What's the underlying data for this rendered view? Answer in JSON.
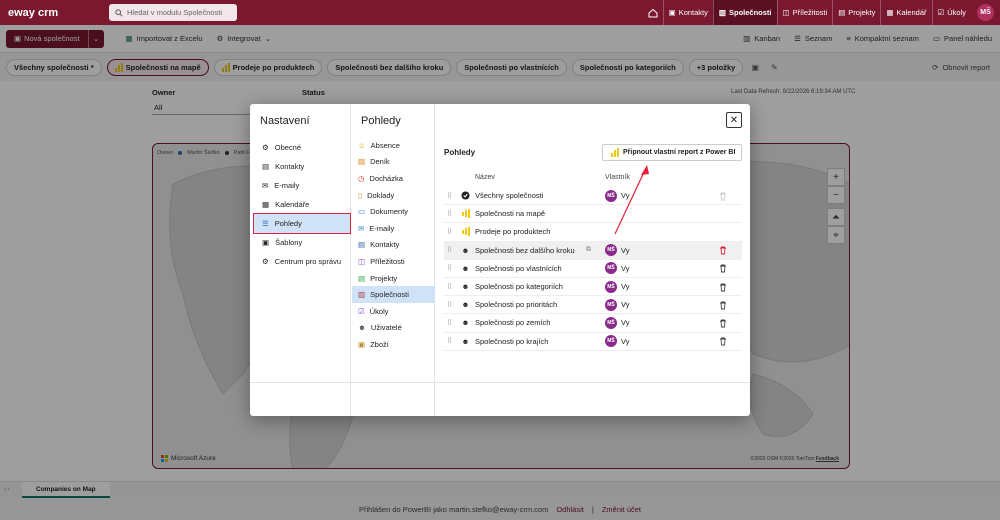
{
  "topbar": {
    "logo": "eway crm",
    "search_placeholder": "Hledat v modulu Společnosti",
    "tabs": [
      {
        "label": "Kontakty",
        "icon": "contacts-icon"
      },
      {
        "label": "Společnosti",
        "icon": "companies-icon",
        "active": true
      },
      {
        "label": "Příležitosti",
        "icon": "opportunities-icon"
      },
      {
        "label": "Projekty",
        "icon": "projects-icon"
      },
      {
        "label": "Kalendář",
        "icon": "calendar-icon"
      },
      {
        "label": "Úkoly",
        "icon": "tasks-icon"
      }
    ],
    "avatar": "MŠ"
  },
  "toolbar": {
    "new_label": "Nová společnost",
    "import_label": "Importovat z Excelu",
    "integrate_label": "Integrovat",
    "kanban_label": "Kanban",
    "list_label": "Seznam",
    "compact_label": "Kompaktní seznam",
    "preview_label": "Panel náhledu"
  },
  "viewbar": {
    "views": [
      {
        "label": "Všechny společnosti *"
      },
      {
        "label": "Společnosti na mapě",
        "active": true
      },
      {
        "label": "Prodeje po produktech"
      },
      {
        "label": "Společnosti bez dalšího kroku"
      },
      {
        "label": "Společnosti po vlastnících"
      },
      {
        "label": "Společnosti po kategoriích"
      },
      {
        "label": "+3 položky"
      }
    ],
    "refresh_label": "Obnovit report"
  },
  "report": {
    "owner_label": "Owner",
    "owner_value": "All",
    "status_label": "Status",
    "last_refresh": "Last Data Refresh: 8/22/2026 6:19:34 AM UTC",
    "legend_owner": "Owner",
    "legend_a": "Martin Štefko",
    "legend_b": "Patti Fer",
    "azure": "Microsoft Azure",
    "copyright": "©2026 OSM ©2026 TomTom",
    "feedback": "Feedback"
  },
  "pagetabs": [
    "Companies on Map"
  ],
  "footer": {
    "signed": "Přihlášen do PowerBI jako martin.stefko@eway-crm.com",
    "logout": "Odhlásit",
    "change": "Změnit účet"
  },
  "modal": {
    "title": "Nastavení",
    "left_items": [
      {
        "label": "Obecné",
        "icon": "gear-icon"
      },
      {
        "label": "Kontakty",
        "icon": "contact-card-icon"
      },
      {
        "label": "E-maily",
        "icon": "mail-icon"
      },
      {
        "label": "Kalendáře",
        "icon": "calendar-icon"
      },
      {
        "label": "Pohledy",
        "icon": "list-icon",
        "active": true
      },
      {
        "label": "Šablony",
        "icon": "template-icon"
      },
      {
        "label": "Centrum pro správu",
        "icon": "admin-icon"
      }
    ],
    "mid_title": "Pohledy",
    "mid_items": [
      {
        "label": "Absence",
        "icon": "smile-icon",
        "color": "#e0a800"
      },
      {
        "label": "Deník",
        "icon": "journal-icon",
        "color": "#d17a00"
      },
      {
        "label": "Docházka",
        "icon": "clock-icon",
        "color": "#c0392b"
      },
      {
        "label": "Doklady",
        "icon": "document-icon",
        "color": "#c08a2b"
      },
      {
        "label": "Dokumenty",
        "icon": "folder-icon",
        "color": "#3a78c8"
      },
      {
        "label": "E-maily",
        "icon": "mail-icon",
        "color": "#2b8ac8"
      },
      {
        "label": "Kontakty",
        "icon": "contact-card-icon",
        "color": "#2b5fa8"
      },
      {
        "label": "Příležitosti",
        "icon": "opportunity-icon",
        "color": "#8a4bc8"
      },
      {
        "label": "Projekty",
        "icon": "project-icon",
        "color": "#2ba84b"
      },
      {
        "label": "Společnosti",
        "icon": "company-icon",
        "color": "#a83a3a",
        "active": true
      },
      {
        "label": "Úkoly",
        "icon": "task-icon",
        "color": "#8a4bc8"
      },
      {
        "label": "Uživatelé",
        "icon": "users-icon",
        "color": "#555555"
      },
      {
        "label": "Zboží",
        "icon": "box-icon",
        "color": "#c08a2b"
      }
    ],
    "right_title": "Pohledy",
    "pin_label": "Připnout vlastní report z Power BI",
    "col_name": "Název",
    "col_owner": "Vlastník",
    "rows": [
      {
        "name": "Všechny společnosti",
        "icon": "eway-icon",
        "owner": "Vy",
        "initials": "MŠ",
        "deletable": false
      },
      {
        "name": "Společnosti na mapě",
        "icon": "powerbi-icon"
      },
      {
        "name": "Prodeje po produktech",
        "icon": "powerbi-icon"
      },
      {
        "name": "Společnosti bez dalšího kroku",
        "icon": "user-view-icon",
        "owner": "Vy",
        "initials": "MŠ",
        "deletable": true,
        "hover": true
      },
      {
        "name": "Společnosti po vlastnících",
        "icon": "user-view-icon",
        "owner": "Vy",
        "initials": "MŠ",
        "deletable": true
      },
      {
        "name": "Společnosti po kategoriích",
        "icon": "user-view-icon",
        "owner": "Vy",
        "initials": "MŠ",
        "deletable": true
      },
      {
        "name": "Společnosti po prioritách",
        "icon": "user-view-icon",
        "owner": "Vy",
        "initials": "MŠ",
        "deletable": true
      },
      {
        "name": "Společnosti po zemích",
        "icon": "user-view-icon",
        "owner": "Vy",
        "initials": "MŠ",
        "deletable": true
      },
      {
        "name": "Společnosti po krajích",
        "icon": "user-view-icon",
        "owner": "Vy",
        "initials": "MŠ",
        "deletable": true
      }
    ]
  }
}
